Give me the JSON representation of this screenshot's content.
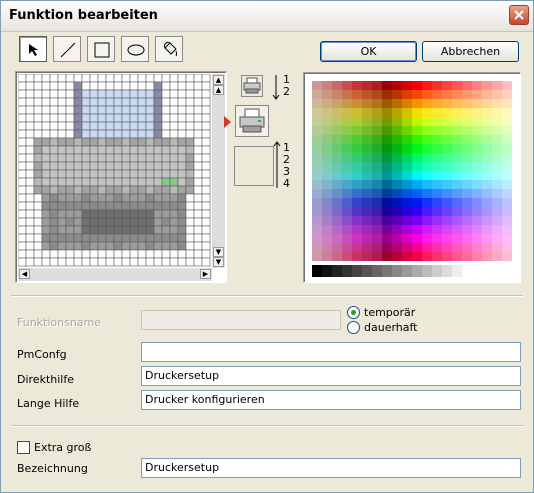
{
  "window": {
    "title": "Funktion bearbeiten"
  },
  "tools": [
    {
      "name": "select-tool",
      "icon": "arrow-pointer-icon"
    },
    {
      "name": "line-tool",
      "icon": "line-icon"
    },
    {
      "name": "rectangle-tool",
      "icon": "rectangle-icon"
    },
    {
      "name": "ellipse-tool",
      "icon": "ellipse-icon"
    },
    {
      "name": "fill-tool",
      "icon": "paint-bucket-icon"
    }
  ],
  "buttons": {
    "ok": "OK",
    "cancel": "Abbrechen"
  },
  "icon_slots": {
    "small_order": [
      "1",
      "2"
    ],
    "large_order": [
      "1",
      "2",
      "3",
      "4"
    ]
  },
  "form": {
    "function_name_label": "Funktionsname",
    "function_name_value": "",
    "radio_temporary": "temporär",
    "radio_permanent": "dauerhaft",
    "pmconfig_label": "PmConfg",
    "pmconfig_value": "",
    "direct_help_label": "Direkthilfe",
    "direct_help_value": "Druckersetup",
    "long_help_label": "Lange Hilfe",
    "long_help_value": "Drucker konfigurieren",
    "extra_large_label": "Extra groß",
    "designation_label": "Bezeichnung",
    "designation_value": "Druckersetup"
  },
  "colors": {
    "accent": "#d03a2a",
    "radio_selected": "#21a121",
    "field_border": "#7f9db9"
  }
}
